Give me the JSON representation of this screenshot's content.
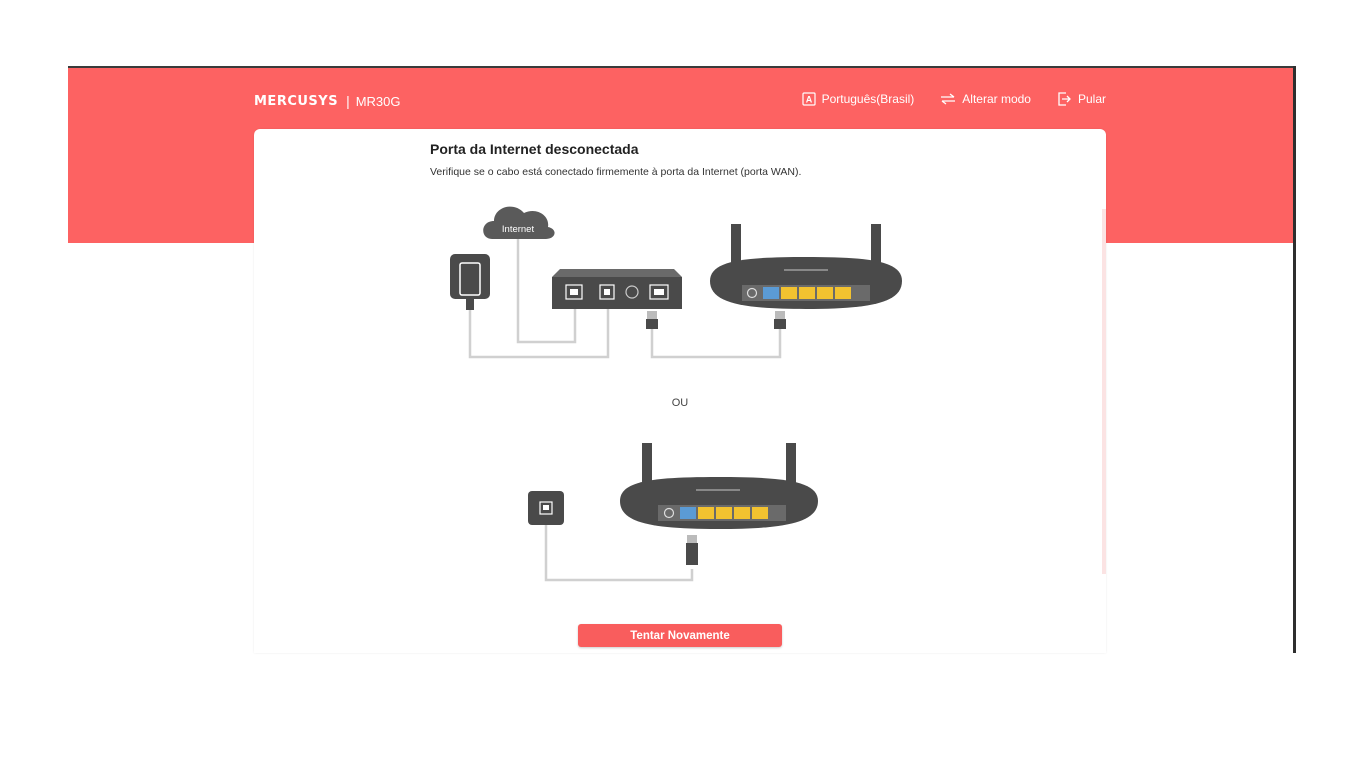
{
  "header": {
    "brand": "MERCUSYS",
    "separator": "|",
    "model": "MR30G",
    "actions": {
      "language": {
        "label": "Português(Brasil)",
        "icon": "language-icon"
      },
      "mode": {
        "label": "Alterar modo",
        "icon": "switch-mode-icon"
      },
      "skip": {
        "label": "Pular",
        "icon": "exit-icon"
      }
    }
  },
  "card": {
    "title": "Porta da Internet desconectada",
    "subtitle": "Verifique se o cabo está conectado firmemente à porta da Internet (porta WAN).",
    "diagram_cloud_label": "Internet",
    "separator_text": "OU",
    "retry_button": "Tentar Novamente"
  },
  "colors": {
    "brand": "#fd6262",
    "button": "#f95d5d",
    "wan_port": "#5b9bd5",
    "lan_port": "#f2c230",
    "device": "#4a4a4a",
    "cable": "#d0d0d0"
  }
}
